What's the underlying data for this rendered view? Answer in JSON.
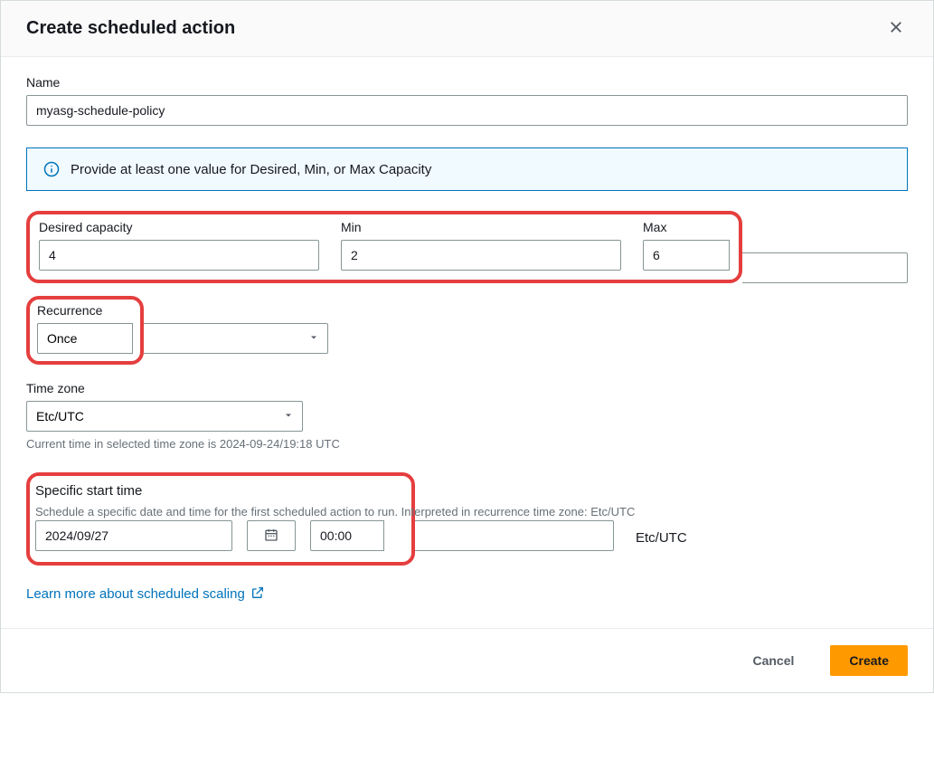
{
  "header": {
    "title": "Create scheduled action"
  },
  "name": {
    "label": "Name",
    "value": "myasg-schedule-policy"
  },
  "info": {
    "text": "Provide at least one value for Desired, Min, or Max Capacity"
  },
  "capacity": {
    "desired_label": "Desired capacity",
    "desired_value": "4",
    "min_label": "Min",
    "min_value": "2",
    "max_label": "Max",
    "max_value": "6"
  },
  "recurrence": {
    "label": "Recurrence",
    "value": "Once"
  },
  "timezone": {
    "label": "Time zone",
    "value": "Etc/UTC",
    "helper": "Current time in selected time zone is 2024-09-24/19:18 UTC"
  },
  "start_time": {
    "label": "Specific start time",
    "helper": "Schedule a specific date and time for the first scheduled action to run. Interpreted in recurrence time zone: Etc/UTC",
    "date_value": "2024/09/27",
    "time_value": "00:00",
    "tz_readout": "Etc/UTC"
  },
  "link": {
    "text": "Learn more about scheduled scaling"
  },
  "footer": {
    "cancel": "Cancel",
    "create": "Create"
  }
}
